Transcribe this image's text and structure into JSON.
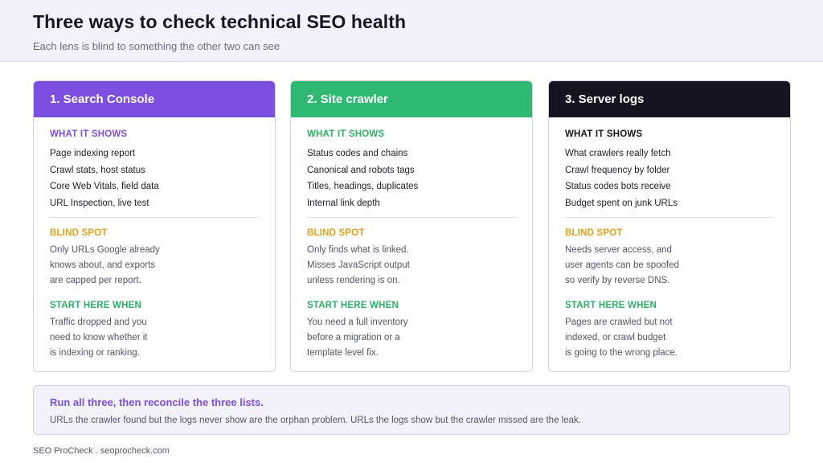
{
  "header": {
    "title": "Three ways to check technical SEO health",
    "subtitle": "Each lens is blind to something the other two can see"
  },
  "colors": {
    "purple": "#7c4fe0",
    "green": "#2eb872",
    "dark": "#16141f",
    "gold": "#e0a21c",
    "start_green": "#2eaf67"
  },
  "cards": [
    {
      "title": "1. Search Console",
      "shows_label": "WHAT IT SHOWS",
      "shows": [
        "Page indexing report",
        "Crawl stats, host status",
        "Core Web Vitals, field data",
        "URL Inspection, live test"
      ],
      "blind_label": "BLIND SPOT",
      "blind": [
        "Only URLs Google already",
        "knows about, and exports",
        "are capped per report."
      ],
      "start_label": "START HERE WHEN",
      "start": [
        "Traffic dropped and you",
        "need to know whether it",
        "is indexing or ranking."
      ]
    },
    {
      "title": "2. Site crawler",
      "shows_label": "WHAT IT SHOWS",
      "shows": [
        "Status codes and chains",
        "Canonical and robots tags",
        "Titles, headings, duplicates",
        "Internal link depth"
      ],
      "blind_label": "BLIND SPOT",
      "blind": [
        "Only finds what is linked.",
        "Misses JavaScript output",
        "unless rendering is on."
      ],
      "start_label": "START HERE WHEN",
      "start": [
        "You need a full inventory",
        "before a migration or a",
        "template level fix."
      ]
    },
    {
      "title": "3. Server logs",
      "shows_label": "WHAT IT SHOWS",
      "shows": [
        "What crawlers really fetch",
        "Crawl frequency by folder",
        "Status codes bots receive",
        "Budget spent on junk URLs"
      ],
      "blind_label": "BLIND SPOT",
      "blind": [
        "Needs server access, and",
        "user agents can be spoofed",
        "so verify by reverse DNS."
      ],
      "start_label": "START HERE WHEN",
      "start": [
        "Pages are crawled but not",
        "indexed, or crawl budget",
        "is going to the wrong place."
      ]
    }
  ],
  "summary": {
    "heading": "Run all three, then reconcile the three lists.",
    "text": "URLs the crawler found but the logs never show are the orphan problem. URLs the logs show but the crawler missed are the leak."
  },
  "footer": "SEO ProCheck . seoprocheck.com"
}
